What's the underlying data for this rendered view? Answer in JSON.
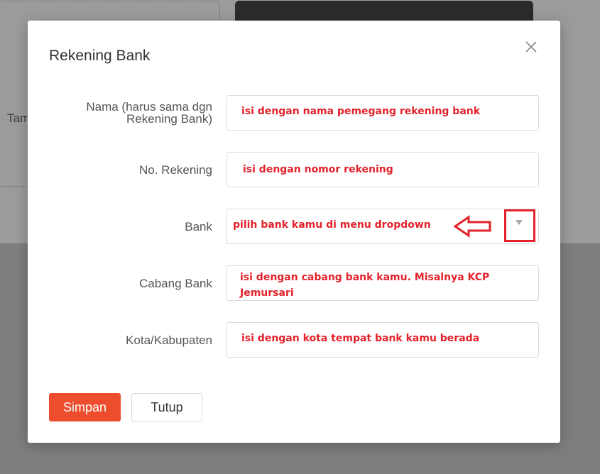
{
  "background": {
    "partial_text": "Tam"
  },
  "modal": {
    "title": "Rekening Bank",
    "fields": [
      {
        "label_line1": "Nama (harus sama dgn",
        "label_line2": "Rekening Bank)",
        "note": "isi dengan nama pemegang rekening bank"
      },
      {
        "label": "No. Rekening",
        "note": "isi dengan nomor rekening"
      },
      {
        "label": "Bank",
        "note": "pilih bank kamu di menu dropdown"
      },
      {
        "label": "Cabang Bank",
        "note_line1": "isi dengan cabang bank kamu. Misalnya KCP",
        "note_line2": "Jemursari"
      },
      {
        "label": "Kota/Kabupaten",
        "note": "isi dengan kota tempat bank kamu berada"
      }
    ],
    "save_label": "Simpan",
    "close_label": "Tutup"
  },
  "colors": {
    "accent": "#ee4d2d",
    "annotation_red": "#e3222b"
  },
  "icons": {
    "close": "close-icon",
    "dropdown": "triangle-down-icon",
    "pointer": "left-arrow-icon"
  }
}
